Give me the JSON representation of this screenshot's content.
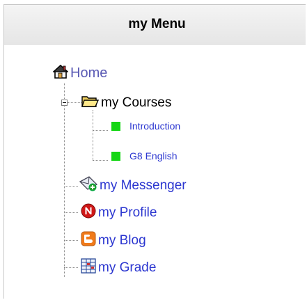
{
  "block": {
    "title": "my Menu"
  },
  "menu": {
    "home": {
      "label": "Home",
      "icon": "home-icon"
    },
    "courses": {
      "label": "my Courses",
      "icon": "folder-open-icon",
      "expanded": true,
      "children": [
        {
          "label": "Introduction",
          "icon": "green-square-icon"
        },
        {
          "label": "G8 English",
          "icon": "green-square-icon"
        }
      ]
    },
    "items": [
      {
        "label": "my Messenger",
        "icon": "messenger-icon"
      },
      {
        "label": "my Profile",
        "icon": "profile-icon"
      },
      {
        "label": "my Blog",
        "icon": "blog-icon"
      },
      {
        "label": "my Grade",
        "icon": "grade-icon"
      }
    ]
  },
  "colors": {
    "link": "#2b36d0",
    "home_link": "#5a5ab4",
    "course_square": "#15d615",
    "header_bg": "#ececec"
  }
}
